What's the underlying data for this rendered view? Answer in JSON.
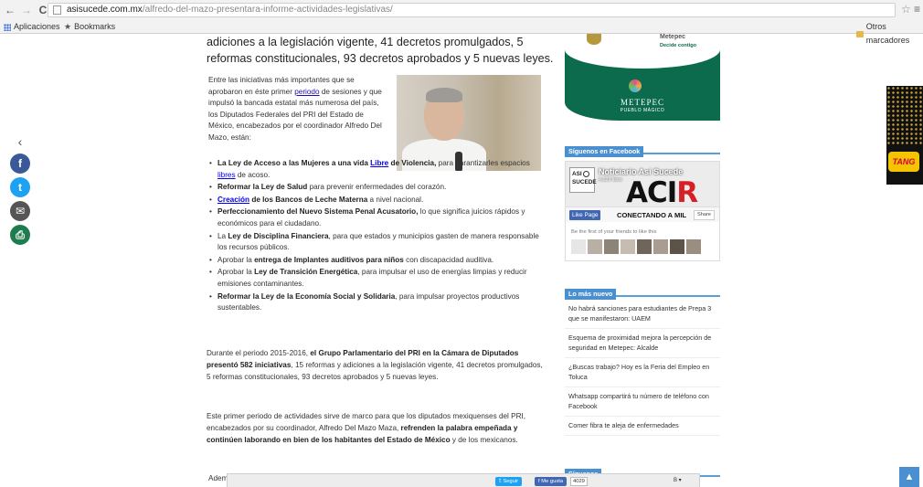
{
  "browser": {
    "url_host": "asisucede.com.mx",
    "url_path": "/alfredo-del-mazo-presentara-informe-actividades-legislativas/",
    "bookmarks": {
      "apps_label": "Aplicaciones",
      "bookmarks_label": "Bookmarks",
      "other_label": "Otros marcadores"
    }
  },
  "article": {
    "lead": "adiciones a la legislación vigente, 41 decretos promulgados, 5 reformas constitucionales, 93 decretos aprobados y 5 nuevas leyes.",
    "intro_before_link": "Entre las iniciativas más importantes que se aprobaron en éste primer ",
    "intro_link": "periodo",
    "intro_after_link": " de sesiones y que impulsó la bancada estatal más numerosa del país, los Diputados Federales del PRI del Estado de México, encabezados por el coordinador Alfredo Del Mazo, están:",
    "bullets": [
      {
        "b1": "La Ley de Acceso a las Mujeres a una vida ",
        "link": "Libre",
        "b2": " de Violencia,",
        "rest": " para garantizarles espacios ",
        "link2": "libres",
        "rest2": " de acoso."
      },
      {
        "b1": "Reformar la Ley de Salud",
        "rest": " para prevenir enfermedades del corazón."
      },
      {
        "link": "Creación",
        "b1": " de los Bancos de Leche Materna",
        "rest": " a nivel nacional."
      },
      {
        "b1": "Perfeccionamiento del Nuevo Sistema Penal Acusatorio,",
        "rest": " lo que significa juicios rápidos y económicos para el ciudadano."
      },
      {
        "pre": "La ",
        "b1": "Ley de Disciplina Financiera",
        "rest": ", para que estados y municipios gasten de manera responsable los recursos públicos."
      },
      {
        "pre": "Aprobar la ",
        "b1": "entrega de Implantes auditivos para niños",
        "rest": " con discapacidad auditiva."
      },
      {
        "pre": "Aprobar la ",
        "b1": "Ley de Transición Energética",
        "rest": ", para impulsar el uso de energías limpias y reducir emisiones contaminantes."
      },
      {
        "b1": "Reformar la Ley de la Economía Social y Solidaria",
        "rest": ", para impulsar proyectos productivos sustentables."
      }
    ],
    "para1_pre": "Durante el periodo 2015-2016, ",
    "para1_bold": "el Grupo Parlamentario del PRI en la Cámara de Diputados presentó 582 iniciativas",
    "para1_rest": ", 15 reformas y adiciones a la legislación vigente, 41 decretos promulgados, 5 reformas constitucionales, 93 decretos aprobados y 5 nuevas leyes.",
    "para2_pre": "Este primer periodo de actividades sirve de marco para que los diputados mexiquenses del PRI, encabezados por su coordinador, Alfredo Del Mazo Maza, ",
    "para2_bold": "refrenden la palabra empeñada y continúen laborando en bien de los habitantes del Estado de México",
    "para2_rest": " y de los mexicanos.",
    "truncated": "Adem"
  },
  "sidebar": {
    "ad": {
      "name": "METEPEC",
      "sub": "PUEBLO MÁGICO",
      "top": "Metepec",
      "tagline": "Decide contigo"
    },
    "facebook_heading": "Síguenos en Facebook",
    "fb": {
      "page_name": "Noticiario Así Sucede",
      "likes": "4,029 likes",
      "avatar_line1": "ASI",
      "avatar_line2": "SUCEDE",
      "banner_a": "ACI",
      "banner_b": "R",
      "like_page": "Like Page",
      "conectando": "CONECTANDO A MIL",
      "share": "Share",
      "friends_text": "Be the first of your friends to like this"
    },
    "news_heading": "Lo más nuevo",
    "news": [
      "No habrá sanciones para estudiantes de Prepa 3 que se manifestaron: UAEM",
      "Esquema de proximidad mejora la percepción de seguridad en Metepec: Alcalde",
      "¿Buscas trabajo? Hoy es la Feria del Empleo en Toluca",
      "Whatsapp compartirá tu número de teléfono con Facebook",
      "Comer fibra te aleja de enfermedades"
    ],
    "follow_heading": "Síguenos"
  },
  "right_ad": {
    "brand": "TANG"
  },
  "bottom_bar": {
    "tweet": "Seguir",
    "like": "Me gusta",
    "count": "4029",
    "more": "B ▾"
  },
  "colors": {
    "accent": "#4a90d0",
    "link": "#1a0dab",
    "facebook": "#3b5998",
    "twitter": "#1da1f2",
    "ad_green": "#0c6b4d"
  }
}
